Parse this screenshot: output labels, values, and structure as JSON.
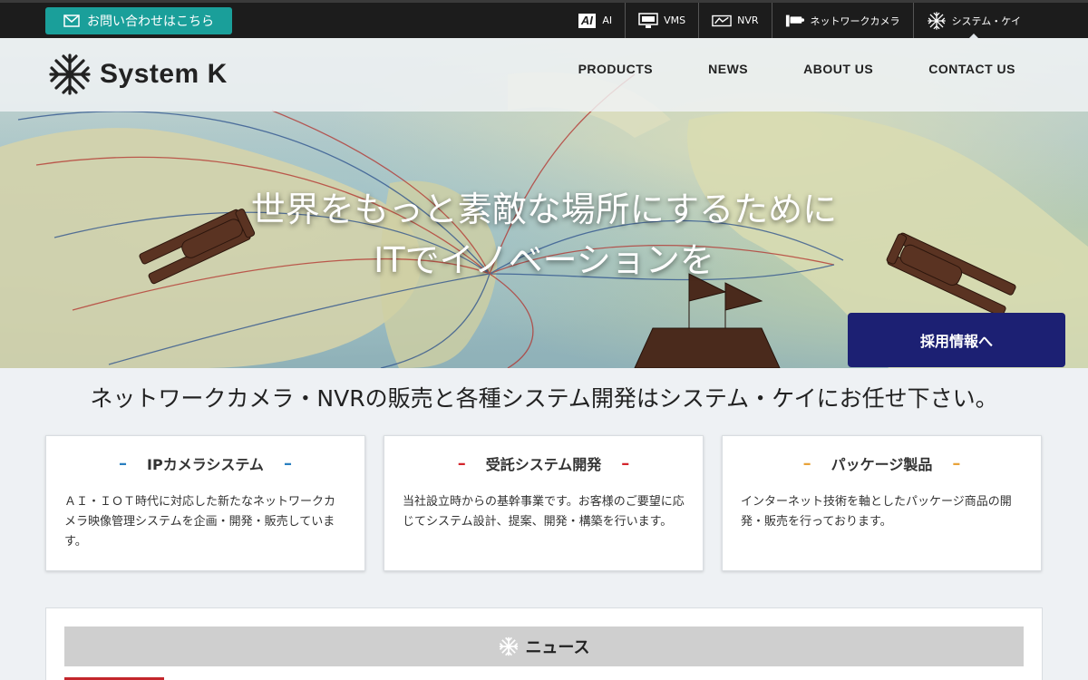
{
  "topbar": {
    "contact_label": "お問い合わせはこちら",
    "nav": [
      {
        "label": "AI",
        "icon": "ai-icon"
      },
      {
        "label": "VMS",
        "icon": "monitor-icon"
      },
      {
        "label": "NVR",
        "icon": "nvr-icon"
      },
      {
        "label": "ネットワークカメラ",
        "icon": "camera-icon"
      },
      {
        "label": "システム・ケイ",
        "icon": "systemk-logo-icon"
      }
    ]
  },
  "header": {
    "logo_text": "System K",
    "nav": [
      "PRODUCTS",
      "NEWS",
      "ABOUT US",
      "CONTACT US"
    ]
  },
  "hero": {
    "line1": "世界をもっと素敵な場所にするために",
    "line2": "ITでイノベーションを",
    "recruit_label": "採用情報へ"
  },
  "tagline": "ネットワークカメラ・NVRの販売と各種システム開発はシステム・ケイにお任せ下さい。",
  "services": [
    {
      "title": "IPカメラシステム",
      "accent": "#2a7fc0",
      "desc": "ＡＩ・ＩＯＴ時代に対応した新たなネットワークカメラ映像管理システムを企画・開発・販売しています。"
    },
    {
      "title": "受託システム開発",
      "accent": "#d3252c",
      "desc": "当社設立時からの基幹事業です。お客様のご要望に応じてシステム設計、提案、開発・構築を行います。"
    },
    {
      "title": "パッケージ製品",
      "accent": "#e8a33a",
      "desc": "インターネット技術を軸としたパッケージ商品の開発・販売を行っております。"
    }
  ],
  "news": {
    "heading": "ニュース",
    "accent": "#c3262c"
  },
  "colors": {
    "contact_button": "#1a9f9a",
    "recruit_button": "#1c2073",
    "topbar": "#1c1c1c"
  }
}
